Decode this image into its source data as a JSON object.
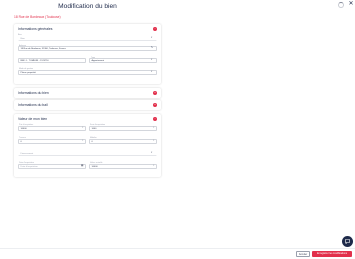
{
  "header": {
    "title": "Modification du bien",
    "address": "18 Rue de Bordeaux (Toulouse)"
  },
  "general": {
    "title": "Informations générales",
    "fields": {
      "bien_label": "Bien",
      "bien_value": "Bien",
      "adresse_label": "Adresse",
      "adresse_value": "18 Rue de Bordeaux, 31300, Toulouse, France",
      "ref_value": "REF-1 - TOMEUR - 1574716",
      "type_label": "Type",
      "type_value": "Appartement",
      "mode_label": "Mode de gestion",
      "mode_value": "Pleine propriété"
    }
  },
  "sections": {
    "info1_title": "Informations du bien",
    "info2_title": "Informations du bail"
  },
  "valeur": {
    "title": "Valeur de mon bien",
    "fields": {
      "prix_label": "Prix d'acquisition",
      "prix_value": "10000",
      "prix_suffix": "€",
      "frais_label": "Frais d'acquisition",
      "frais_value": "1000",
      "frais_suffix": "€",
      "travaux_label": "Travaux",
      "travaux_value": "0",
      "travaux_suffix": "€",
      "mobilier_label": "Mobilier",
      "mobilier_value": "0",
      "mobilier_suffix": "€",
      "financement_placeholder": "Financement",
      "date_label": "Date d'acquisition",
      "date_placeholder": "Date d'acquisition",
      "valeur_label": "Valeur actuelle",
      "valeur_value": "10000",
      "valeur_suffix": "€"
    }
  },
  "footer": {
    "cancel_label": "Annuler",
    "save_label": "Enregistrer les modifications"
  },
  "colors": {
    "accent": "#e2304c",
    "navy": "#1e2a4a"
  }
}
